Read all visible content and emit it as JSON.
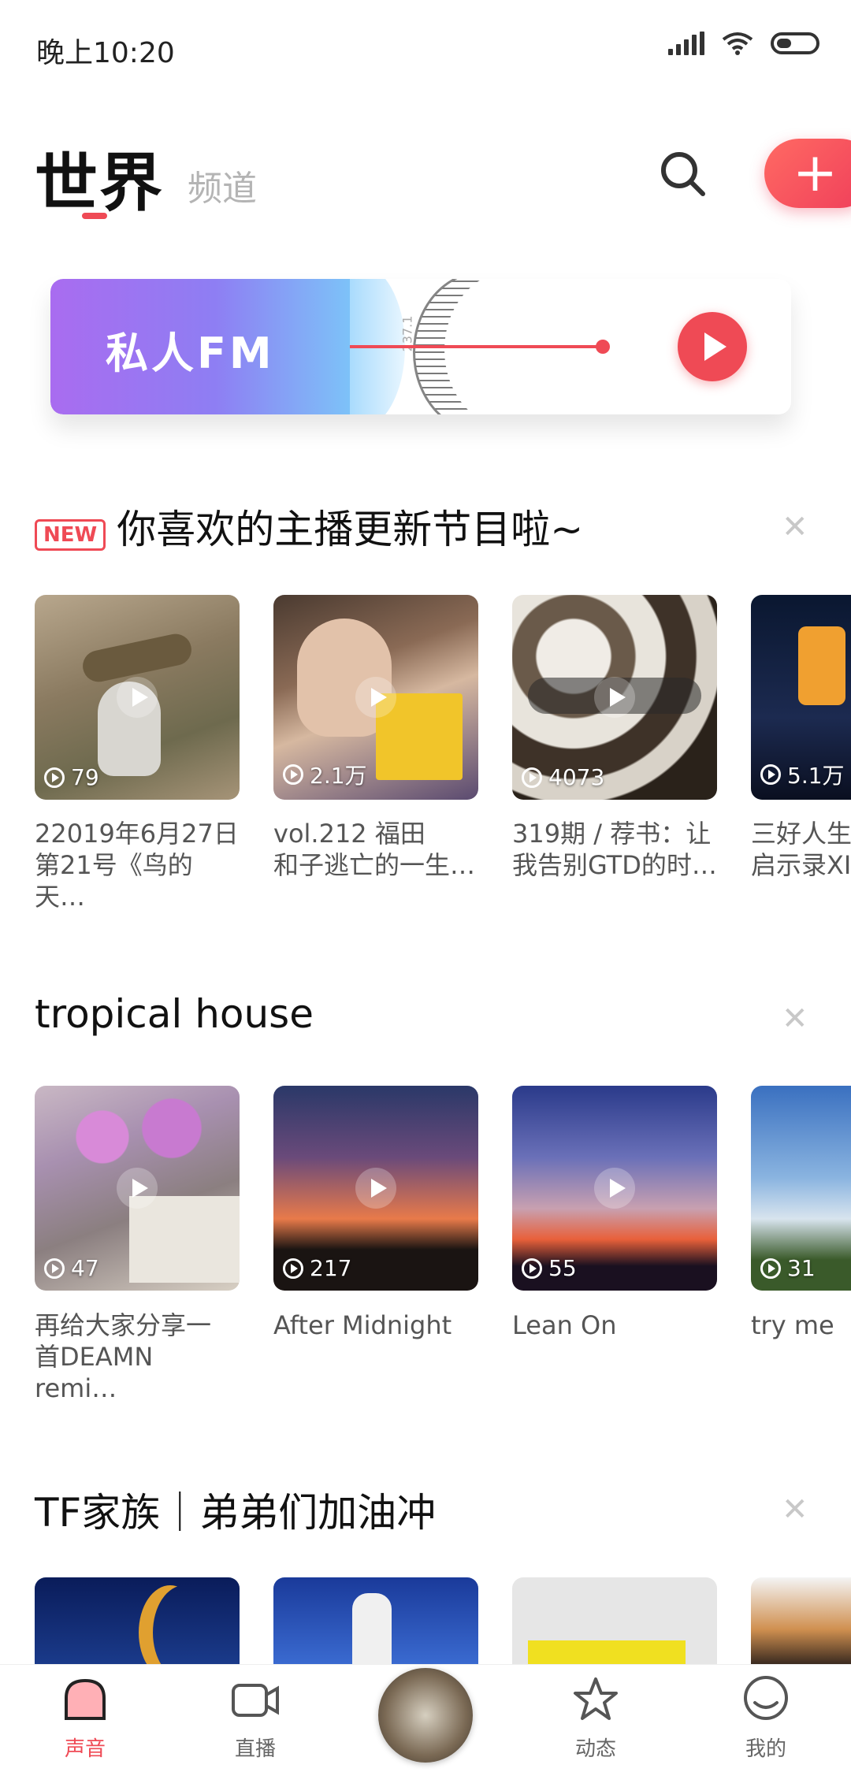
{
  "status": {
    "time": "晚上10:20"
  },
  "header": {
    "title": "世界",
    "subtitle": "频道"
  },
  "fm": {
    "label": "私人FM",
    "dial_text": "237.1"
  },
  "sections": [
    {
      "badge": "NEW",
      "title": "你喜欢的主播更新节目啦~",
      "items": [
        {
          "count": "79",
          "caption": "22019年6月27日\n第21号《鸟的天…"
        },
        {
          "count": "2.1万",
          "caption": " vol.212  福田\n和子逃亡的一生…"
        },
        {
          "count": "4073",
          "caption": "319期 / 荐书：让\n我告别GTD的时…"
        },
        {
          "count": "5.1万",
          "caption": "三好人生\n启示录XI"
        }
      ]
    },
    {
      "title": "tropical house",
      "items": [
        {
          "count": "47",
          "caption": "再给大家分享一\n首DEAMN remi…"
        },
        {
          "count": "217",
          "caption": "After Midnight"
        },
        {
          "count": "55",
          "caption": "Lean On"
        },
        {
          "count": "31",
          "caption": "try me"
        }
      ]
    },
    {
      "title": "TF家族｜弟弟们加油冲"
    }
  ],
  "nav": [
    {
      "label": "声音",
      "icon": "home-sound-icon",
      "active": true
    },
    {
      "label": "直播",
      "icon": "video-camera-icon"
    },
    {
      "label": "",
      "icon": "now-playing-disc-icon"
    },
    {
      "label": "动态",
      "icon": "star-icon"
    },
    {
      "label": "我的",
      "icon": "profile-icon"
    }
  ],
  "colors": {
    "accent": "#ef4a55"
  }
}
